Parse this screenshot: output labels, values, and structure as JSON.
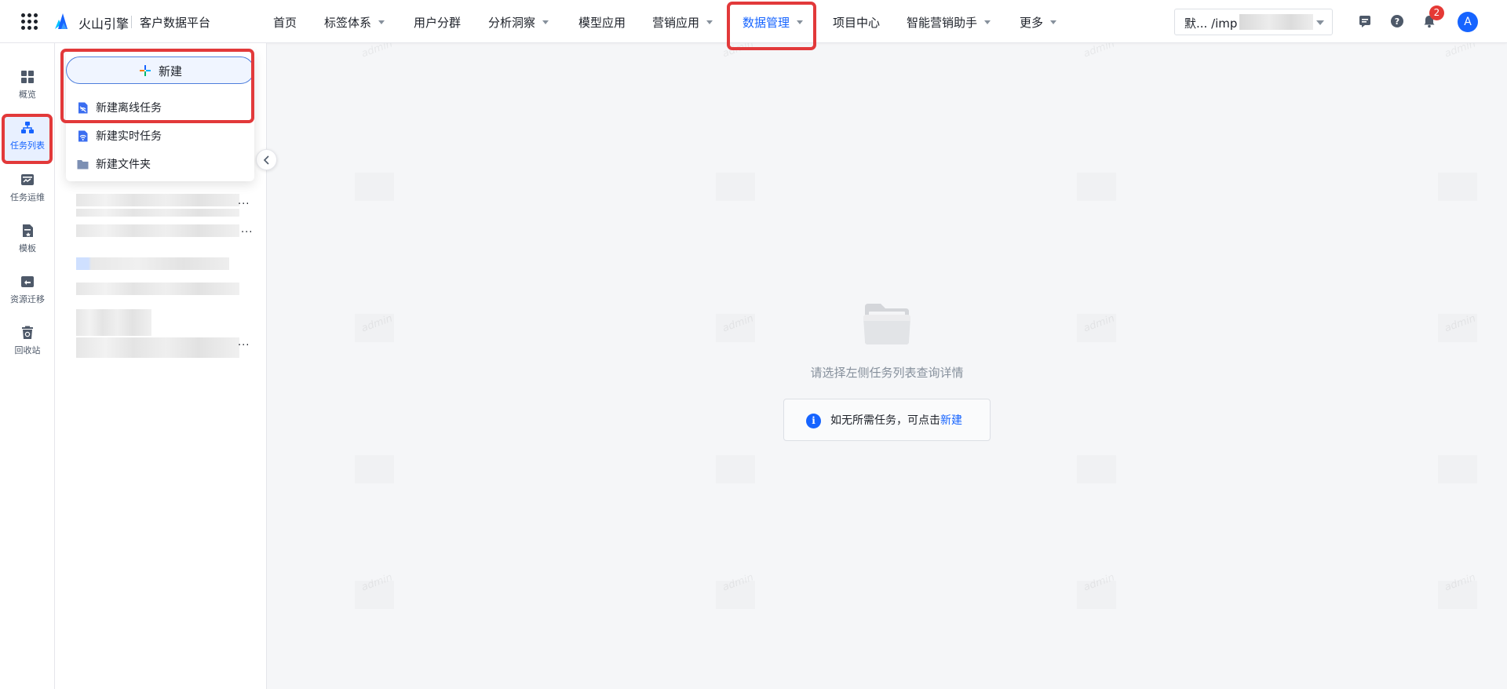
{
  "header": {
    "brand_name": "火山引擎",
    "product_name": "客户数据平台",
    "nav": [
      {
        "label": "首页",
        "has_caret": false
      },
      {
        "label": "标签体系",
        "has_caret": true
      },
      {
        "label": "用户分群",
        "has_caret": false
      },
      {
        "label": "分析洞察",
        "has_caret": true
      },
      {
        "label": "模型应用",
        "has_caret": false
      },
      {
        "label": "营销应用",
        "has_caret": true
      },
      {
        "label": "数据管理",
        "has_caret": true,
        "active": true
      },
      {
        "label": "项目中心",
        "has_caret": false
      },
      {
        "label": "智能营销助手",
        "has_caret": true
      },
      {
        "label": "更多",
        "has_caret": true
      }
    ],
    "project_select": {
      "value": "默...  /imp"
    },
    "notification_count": "2",
    "avatar_letter": "A"
  },
  "sidebar": {
    "items": [
      {
        "label": "概览",
        "icon": "dashboard-icon"
      },
      {
        "label": "任务列表",
        "icon": "task-list-icon",
        "active": true
      },
      {
        "label": "任务运维",
        "icon": "task-ops-icon"
      },
      {
        "label": "模板",
        "icon": "template-icon"
      },
      {
        "label": "资源迁移",
        "icon": "resource-migration-icon"
      },
      {
        "label": "回收站",
        "icon": "recycle-bin-icon"
      }
    ]
  },
  "new_menu": {
    "button_label": "新建",
    "items": [
      {
        "label": "新建离线任务",
        "icon": "offline-task-icon"
      },
      {
        "label": "新建实时任务",
        "icon": "realtime-task-icon"
      },
      {
        "label": "新建文件夹",
        "icon": "folder-icon"
      }
    ]
  },
  "tree": {
    "ellipsis": "..."
  },
  "empty_state": {
    "message": "请选择左侧任务列表查询详情",
    "tip_text": "如无所需任务，可点击",
    "tip_link": "新建"
  },
  "watermark": "admin",
  "colors": {
    "accent": "#1664ff",
    "highlight_box": "#e2393a",
    "badge": "#e53935"
  }
}
